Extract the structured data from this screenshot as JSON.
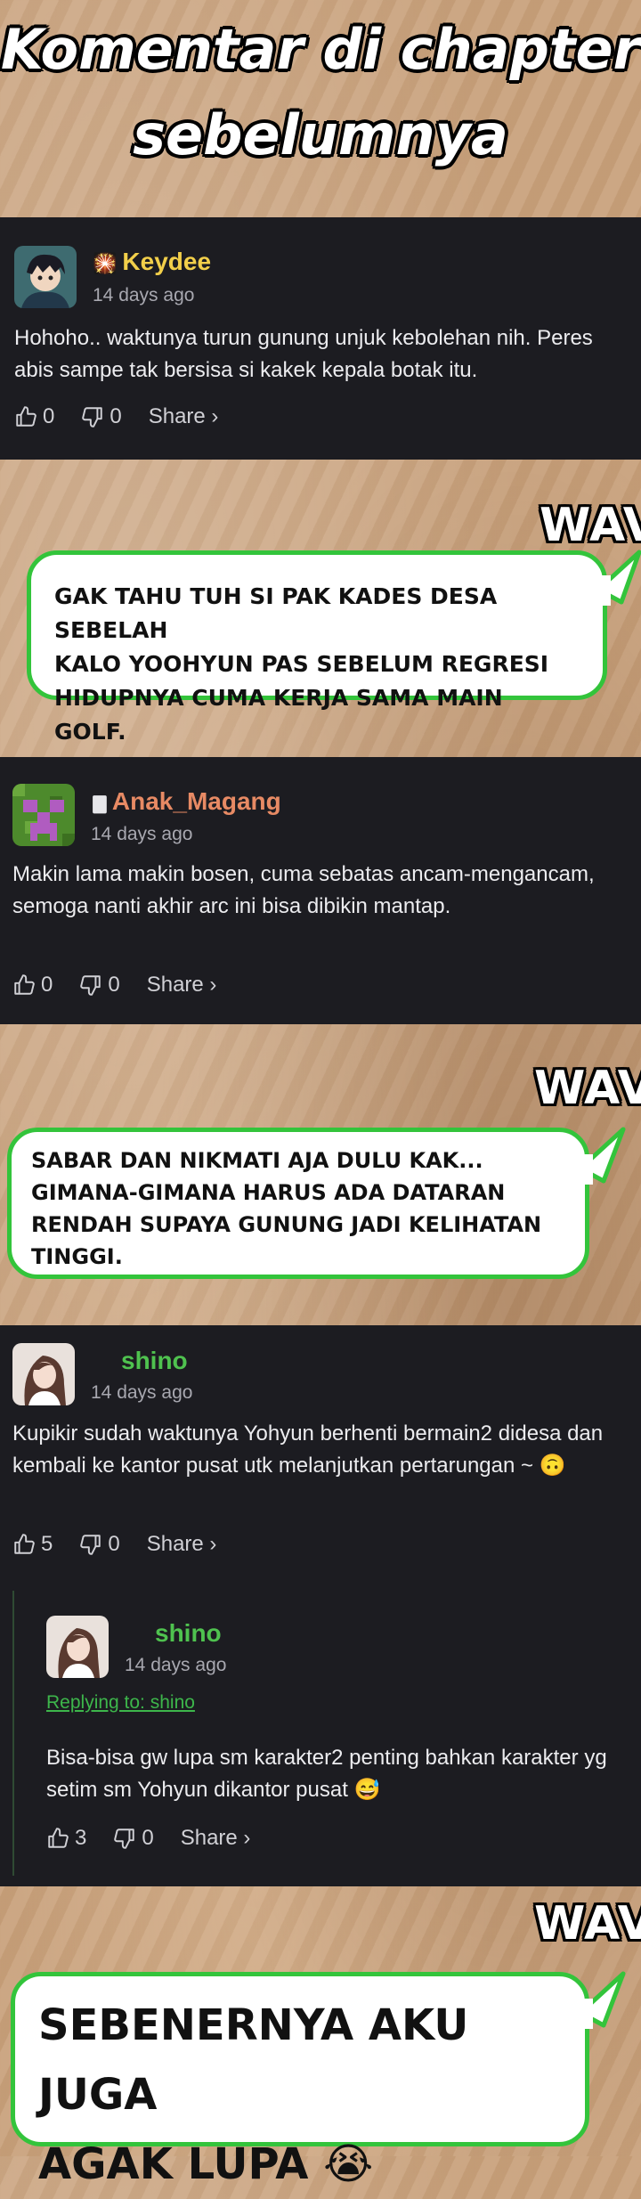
{
  "header": {
    "title_line1": "Komentar di chapter",
    "title_line2": "sebelumnya"
  },
  "comments": [
    {
      "username": "Keydee",
      "badge_icon": "badge-icon",
      "badge_glyph": "🎇",
      "username_color": "#f2cf4a",
      "time": "14 days ago",
      "text": "Hohoho.. waktunya turun gunung unjuk kebolehan nih. Peres abis sampe tak bersisa si kakek kepala botak itu.",
      "likes": "0",
      "dislikes": "0",
      "share_label": "Share ›"
    },
    {
      "username": "Anak_Magang",
      "badge_icon": "badge-icon",
      "badge_glyph": "🀫",
      "username_color": "#e78a64",
      "time": "14 days ago",
      "text": "Makin lama makin bosen, cuma sebatas ancam-mengancam, semoga nanti akhir arc ini bisa dibikin mantap.",
      "likes": "0",
      "dislikes": "0",
      "share_label": "Share ›"
    },
    {
      "username": "shino",
      "username_color": "#4fc24f",
      "time": "14 days ago",
      "text": "Kupikir sudah waktunya Yohyun berhenti bermain2 didesa dan kembali ke kantor pusat utk melanjutkan pertarungan ~ 🙃",
      "likes": "5",
      "dislikes": "0",
      "share_label": "Share ›"
    }
  ],
  "reply": {
    "username": "shino",
    "username_color": "#4fc24f",
    "time": "14 days ago",
    "replying_to": "Replying to: shino",
    "text": "Bisa-bisa gw lupa sm karakter2 penting bahkan karakter yg setim sm Yohyun dikantor pusat 😅",
    "likes": "3",
    "dislikes": "0",
    "share_label": "Share ›"
  },
  "annotations": [
    {
      "tag": "WAV",
      "text": "Gak tahu tuh si pak kades desa sebelah\nkalo Yoohyun pas sebelum regresi\nhidupnya cuma kerja sama main golf."
    },
    {
      "tag": "WAV",
      "text": "Sabar dan nikmati aja dulu kak...\nGimana-gimana harus ada dataran\nrendah supaya gunung jadi kelihatan\ntinggi."
    },
    {
      "tag": "WAV",
      "text": "Sebenernya aku juga\nagak lupa 😭"
    }
  ],
  "colors": {
    "panel_bg": "#1c1c21",
    "bubble_border": "#33c43b",
    "link_green": "#3db64b"
  }
}
